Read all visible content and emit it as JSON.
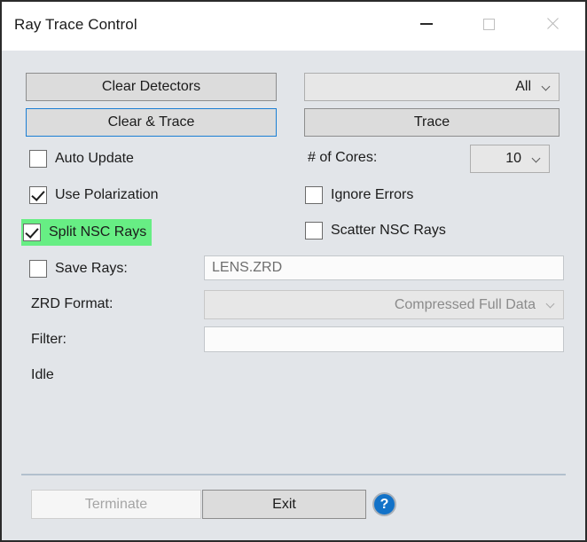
{
  "window": {
    "title": "Ray Trace Control",
    "caption": {
      "minimize": "minimize-icon",
      "maximize": "maximize-icon",
      "close": "close-icon"
    },
    "colors": {
      "body_background": "#e2e5e9",
      "titlebar_background": "#ffffff",
      "highlight_green": "#67ee84",
      "focus_blue": "#1b7fd4",
      "help_blue": "#1272c8",
      "separator": "#b2c0cd"
    }
  },
  "buttons": {
    "clear_detectors": "Clear Detectors",
    "clear_and_trace": "Clear & Trace",
    "trace": "Trace",
    "terminate": "Terminate",
    "exit": "Exit",
    "help": "?"
  },
  "dropdowns": {
    "source_filter": {
      "value": "All",
      "options": [
        "All"
      ]
    },
    "cores": {
      "label": "# of Cores:",
      "value": "10",
      "options": [
        "10"
      ]
    },
    "zrd_format": {
      "label": "ZRD Format:",
      "value": "Compressed Full Data",
      "options": [
        "Compressed Full Data"
      ]
    }
  },
  "checkboxes": {
    "auto_update": {
      "label": "Auto Update",
      "checked": false,
      "highlighted": false
    },
    "use_polarization": {
      "label": "Use Polarization",
      "checked": true,
      "highlighted": false
    },
    "split_nsc_rays": {
      "label": "Split NSC Rays",
      "checked": true,
      "highlighted": true
    },
    "ignore_errors": {
      "label": "Ignore Errors",
      "checked": false,
      "highlighted": false
    },
    "scatter_nsc_rays": {
      "label": "Scatter NSC Rays",
      "checked": false,
      "highlighted": false
    },
    "save_rays": {
      "label": "Save Rays:",
      "checked": false,
      "highlighted": false
    }
  },
  "fields": {
    "save_rays_path": {
      "value": "LENS.ZRD",
      "placeholder": ""
    },
    "filter": {
      "label": "Filter:",
      "value": "",
      "placeholder": ""
    }
  },
  "status": {
    "text": "Idle"
  }
}
